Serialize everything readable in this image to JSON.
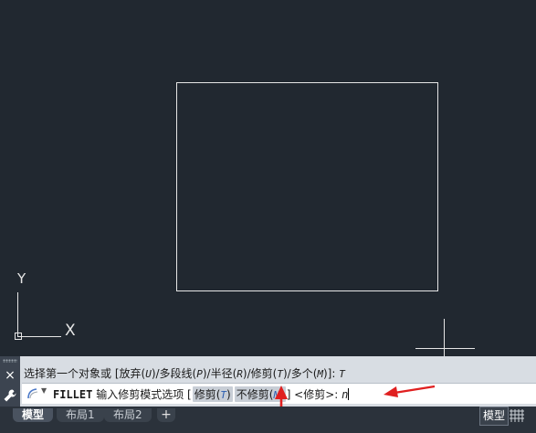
{
  "ucs": {
    "y_label": "Y",
    "x_label": "X"
  },
  "command_line": {
    "history_text_prefix": "选择第一个对象或 [放弃(",
    "history_opts": [
      {
        "pre": "放弃(",
        "key": "U",
        "post": ")/"
      },
      {
        "pre": "多段线(",
        "key": "P",
        "post": ")/"
      },
      {
        "pre": "半径(",
        "key": "R",
        "post": ")/"
      },
      {
        "pre": "修剪(",
        "key": "T",
        "post": ")/"
      },
      {
        "pre": "多个(",
        "key": "M",
        "post": ")]: "
      }
    ],
    "history_lead": "选择第一个对象或 [",
    "history_answer": "T",
    "command_name": "FILLET",
    "prompt_label": "输入修剪模式选项 [",
    "option1_label": "修剪(",
    "option1_key": "T",
    "option1_close": ")",
    "option2_label": "不修剪(",
    "option2_key": "N",
    "option2_close": ")",
    "prompt_default": "] <修剪>: ",
    "input_value": "n",
    "close_icon": "×"
  },
  "tabs": [
    {
      "label": "模型",
      "active": true
    },
    {
      "label": "布局1",
      "active": false
    },
    {
      "label": "布局2",
      "active": false
    }
  ],
  "tab_add_label": "+",
  "status_bar": {
    "model_label": "模型"
  },
  "colors": {
    "canvas": "#212830",
    "annotation_arrow": "#e02020"
  }
}
